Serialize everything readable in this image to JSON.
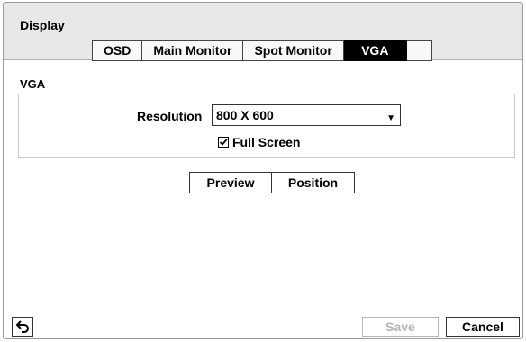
{
  "window": {
    "title": "Display"
  },
  "tabs": [
    {
      "label": "OSD",
      "active": false
    },
    {
      "label": "Main Monitor",
      "active": false
    },
    {
      "label": "Spot Monitor",
      "active": false
    },
    {
      "label": "VGA",
      "active": true
    }
  ],
  "section": {
    "label": "VGA"
  },
  "resolution": {
    "label": "Resolution",
    "value": "800 X 600",
    "arrow_icon": "dropdown-arrow-icon"
  },
  "full_screen": {
    "label": "Full Screen",
    "checked": true
  },
  "buttons": {
    "preview": "Preview",
    "position": "Position"
  },
  "footer": {
    "back_icon": "return-arrow-icon",
    "save": "Save",
    "save_enabled": false,
    "cancel": "Cancel"
  },
  "colors": {
    "header_bg": "#e8e8e8",
    "active_tab_bg": "#000000",
    "active_tab_text": "#ffffff",
    "disabled_text": "#b5b5b5"
  }
}
